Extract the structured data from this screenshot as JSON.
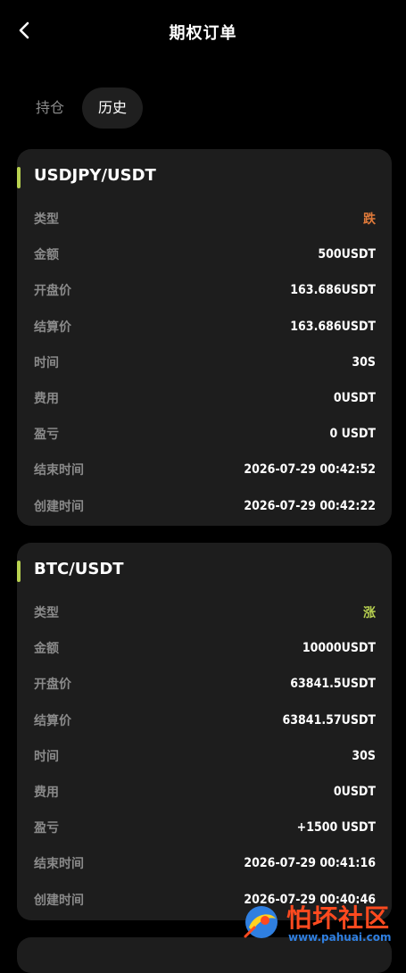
{
  "header": {
    "title": "期权订单",
    "back_icon": "chevron-left-icon"
  },
  "tabs": [
    {
      "label": "持仓",
      "active": false
    },
    {
      "label": "历史",
      "active": true
    }
  ],
  "colors": {
    "accent": "#b8d150",
    "down": "#e07a3a",
    "up": "#b8d150"
  },
  "orders": [
    {
      "pair": "USDJPY/USDT",
      "rows": [
        {
          "label": "类型",
          "value": "跌"
        },
        {
          "label": "金额",
          "value": "500USDT"
        },
        {
          "label": "开盘价",
          "value": "163.686USDT"
        },
        {
          "label": "结算价",
          "value": "163.686USDT"
        },
        {
          "label": "时间",
          "value": "30S"
        },
        {
          "label": "费用",
          "value": "0USDT"
        },
        {
          "label": "盈亏",
          "value": "0 USDT"
        },
        {
          "label": "结束时间",
          "value": "2026-07-29 00:42:52"
        },
        {
          "label": "创建时间",
          "value": "2026-07-29 00:42:22"
        }
      ]
    },
    {
      "pair": "BTC/USDT",
      "rows": [
        {
          "label": "类型",
          "value": "涨"
        },
        {
          "label": "金额",
          "value": "10000USDT"
        },
        {
          "label": "开盘价",
          "value": "63841.5USDT"
        },
        {
          "label": "结算价",
          "value": "63841.57USDT"
        },
        {
          "label": "时间",
          "value": "30S"
        },
        {
          "label": "费用",
          "value": "0USDT"
        },
        {
          "label": "盈亏",
          "value": "+1500 USDT"
        },
        {
          "label": "结束时间",
          "value": "2026-07-29 00:41:16"
        },
        {
          "label": "创建时间",
          "value": "2026-07-29 00:40:46"
        }
      ]
    }
  ],
  "watermark": {
    "text": "怕坏社区",
    "url": "www.pahuai.com"
  }
}
